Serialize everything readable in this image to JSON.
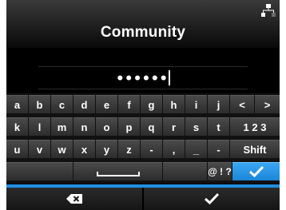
{
  "header": {
    "title": "Community",
    "status_icon": "network-icon"
  },
  "input": {
    "value": "••••••"
  },
  "keyboard": {
    "row1": [
      "a",
      "b",
      "c",
      "d",
      "e",
      "f",
      "g",
      "h",
      "i",
      "j",
      "<",
      ">"
    ],
    "row2": [
      "k",
      "l",
      "m",
      "n",
      "o",
      "p",
      "q",
      "r",
      "s",
      "t",
      "1 2 3"
    ],
    "row3": [
      "u",
      "v",
      "w",
      "x",
      "y",
      "z",
      "-",
      ",",
      "_",
      "-",
      "Shift"
    ],
    "row4": {
      "space_icon": "space-bar-icon",
      "symbols": "@ ! ?",
      "ok_icon": "check-icon"
    }
  },
  "footer": {
    "left_icon": "backspace-icon",
    "right_icon": "check-icon"
  },
  "colors": {
    "accent": "#1f8fe0",
    "key": "#3a3a3a",
    "background": "#0c0c0c"
  }
}
